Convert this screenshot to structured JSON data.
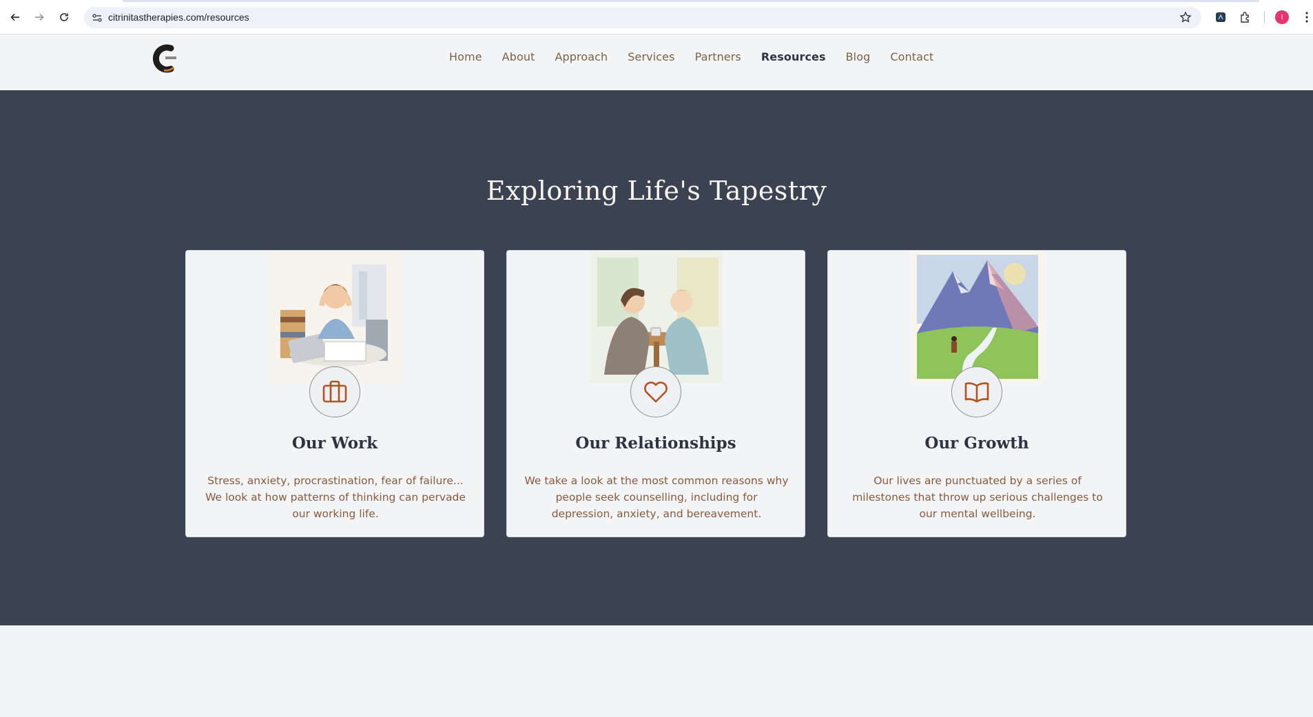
{
  "browser": {
    "url": "citrinitastherapies.com/resources",
    "profile_initial": "I"
  },
  "header": {
    "nav": [
      {
        "label": "Home",
        "active": false
      },
      {
        "label": "About",
        "active": false
      },
      {
        "label": "Approach",
        "active": false
      },
      {
        "label": "Services",
        "active": false
      },
      {
        "label": "Partners",
        "active": false
      },
      {
        "label": "Resources",
        "active": true
      },
      {
        "label": "Blog",
        "active": false
      },
      {
        "label": "Contact",
        "active": false
      }
    ]
  },
  "hero": {
    "title": "Exploring Life's Tapestry",
    "cards": [
      {
        "title": "Our Work",
        "icon": "briefcase-icon",
        "text": "Stress, anxiety, procrastination, fear of failure... We look at how patterns of thinking can pervade our working life."
      },
      {
        "title": "Our Relationships",
        "icon": "heart-icon",
        "text": "We take a look at the most common reasons why people seek counselling, including for depression, anxiety, and bereavement."
      },
      {
        "title": "Our Growth",
        "icon": "book-open-icon",
        "text": "Our lives are punctuated by a series of milestones that throw up serious challenges to our mental wellbeing."
      }
    ]
  },
  "colors": {
    "hero_bg": "#3b4252",
    "accent": "#b4521a",
    "nav_text": "#7a6248",
    "body_text": "#8b5a3c"
  }
}
